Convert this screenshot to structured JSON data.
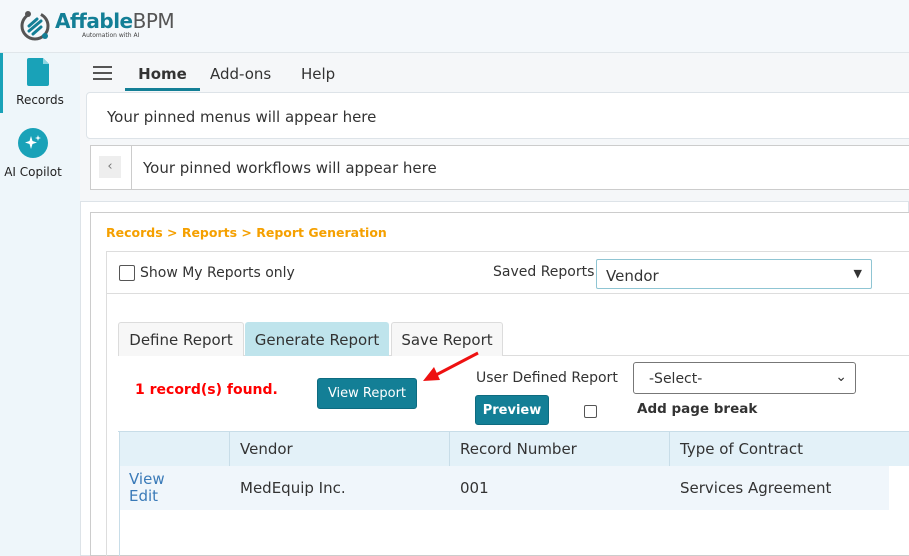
{
  "brand": {
    "name_a": "Affable",
    "name_b": "BPM",
    "tagline": "Automation with AI"
  },
  "sidebar": {
    "items": [
      {
        "label": "Records",
        "icon": "document-icon"
      },
      {
        "label": "AI Copilot",
        "icon": "sparkle-icon"
      }
    ]
  },
  "nav": {
    "tabs": [
      {
        "label": "Home",
        "active": true
      },
      {
        "label": "Add-ons"
      },
      {
        "label": "Help"
      }
    ]
  },
  "pinned": {
    "menus": "Your pinned menus will appear here",
    "workflows": "Your pinned workflows will appear here"
  },
  "breadcrumb": "Records > Reports > Report Generation",
  "filters": {
    "show_mine_label": "Show My Reports only",
    "saved_reports_label": "Saved Reports",
    "saved_reports_value": "Vendor"
  },
  "report_tabs": [
    {
      "label": "Define Report"
    },
    {
      "label": "Generate Report",
      "active": true
    },
    {
      "label": "Save Report"
    }
  ],
  "actions": {
    "status": "1 record(s) found.",
    "view_report": "View Report",
    "user_defined_label": "User Defined Report",
    "user_defined_value": "-Select-",
    "preview": "Preview",
    "page_break_label": "Add page break"
  },
  "table": {
    "columns": [
      "",
      "Vendor",
      "Record Number",
      "Type of Contract"
    ],
    "rows": [
      {
        "view": "View",
        "edit": "Edit",
        "vendor": "MedEquip Inc.",
        "record_number": "001",
        "type": "Services Agreement"
      }
    ]
  },
  "colors": {
    "accent": "#137f96",
    "breadcrumb": "#f5a000",
    "status": "#ff0000",
    "arrow": "#ee1111"
  }
}
